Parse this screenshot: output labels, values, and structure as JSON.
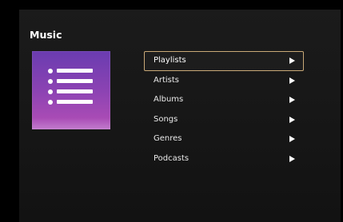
{
  "screen": {
    "title": "Music",
    "art_icon": "playlist-list-icon",
    "art_colors": [
      "#6a3cb0",
      "#a84bb5"
    ],
    "accent": "#c9a977"
  },
  "menu": {
    "items": [
      {
        "label": "Playlists",
        "selected": true
      },
      {
        "label": "Artists",
        "selected": false
      },
      {
        "label": "Albums",
        "selected": false
      },
      {
        "label": "Songs",
        "selected": false
      },
      {
        "label": "Genres",
        "selected": false
      },
      {
        "label": "Podcasts",
        "selected": false
      }
    ],
    "arrow_icon": "play-arrow-icon"
  }
}
